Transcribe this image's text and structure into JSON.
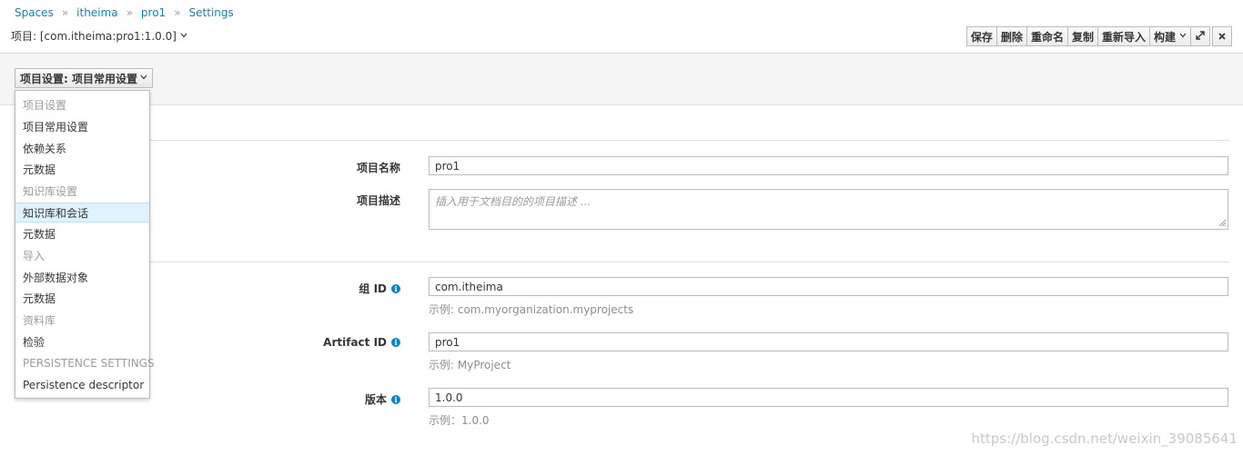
{
  "breadcrumb": {
    "items": [
      "Spaces",
      "itheima",
      "pro1",
      "Settings"
    ],
    "separator": "»"
  },
  "project": {
    "label": "项目: [com.itheima:pro1:1.0.0]",
    "caret_icon": "chevron-down-icon"
  },
  "toolbar": {
    "buttons": [
      "保存",
      "删除",
      "重命名",
      "复制",
      "重新导入",
      "构建"
    ],
    "build_caret_icon": "chevron-down-icon",
    "maximize_icon": "expand-icon",
    "close_icon": "close-icon"
  },
  "settings_dropdown": {
    "toggle_label": "项目设置: 项目常用设置",
    "items": [
      {
        "label": "项目设置",
        "type": "header"
      },
      {
        "label": "项目常用设置",
        "type": "link"
      },
      {
        "label": "依赖关系",
        "type": "link"
      },
      {
        "label": "元数据",
        "type": "link"
      },
      {
        "label": "知识库设置",
        "type": "header"
      },
      {
        "label": "知识库和会话",
        "type": "link",
        "active": true
      },
      {
        "label": "元数据",
        "type": "link"
      },
      {
        "label": "导入",
        "type": "header"
      },
      {
        "label": "外部数据对象",
        "type": "link"
      },
      {
        "label": "元数据",
        "type": "link"
      },
      {
        "label": "资料库",
        "type": "header"
      },
      {
        "label": "检验",
        "type": "link"
      },
      {
        "label": "PERSISTENCE SETTINGS",
        "type": "header"
      },
      {
        "label": "Persistence descriptor",
        "type": "link"
      }
    ]
  },
  "form": {
    "project_name": {
      "label": "项目名称",
      "value": "pro1"
    },
    "project_description": {
      "label": "项目描述",
      "placeholder": "插入用于文档目的的项目描述 ..."
    },
    "group_id": {
      "label": "组 ID",
      "value": "com.itheima",
      "help": "示例: com.myorganization.myprojects"
    },
    "artifact_id": {
      "label": "Artifact ID",
      "value": "pro1",
      "help": "示例: MyProject"
    },
    "version": {
      "label": "版本",
      "value": "1.0.0",
      "help": "示例：1.0.0"
    },
    "info_icon": "info-icon"
  },
  "watermark": "https://blog.csdn.net/weixin_39085641",
  "colors": {
    "link": "#0088ce",
    "active_item_bg": "#def3ff",
    "band_bg": "#f5f5f5",
    "muted_text": "#9c9c9c"
  }
}
